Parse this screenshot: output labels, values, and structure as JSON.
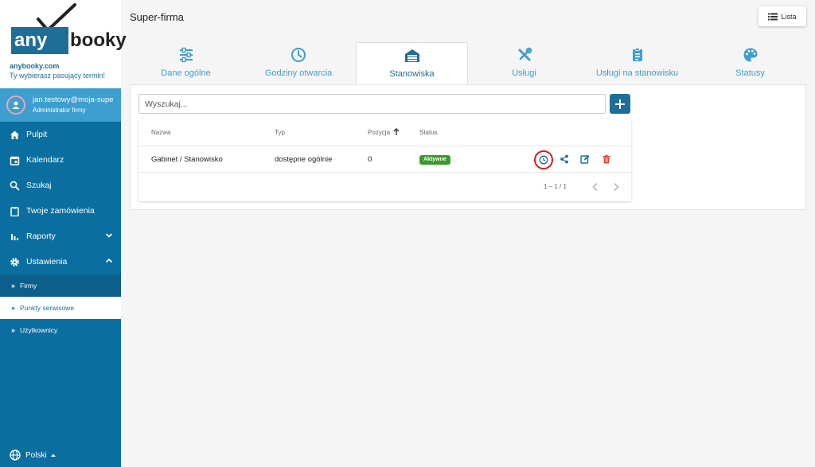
{
  "brand": {
    "logo_left": "any",
    "logo_right": "booky",
    "site": "anybooky.com",
    "tagline": "Ty wybierasz pasujący termin!"
  },
  "user": {
    "email": "jan.testowy@moja-supe",
    "role": "Administrator firmy"
  },
  "sidebar": {
    "items": [
      {
        "label": "Pulpit",
        "icon": "home-icon"
      },
      {
        "label": "Kalendarz",
        "icon": "calendar-icon"
      },
      {
        "label": "Szukaj",
        "icon": "search-icon"
      },
      {
        "label": "Twoje zamówienia",
        "icon": "clipboard-icon"
      },
      {
        "label": "Raporty",
        "icon": "bar-chart-icon"
      },
      {
        "label": "Ustawienia",
        "icon": "gear-icon"
      }
    ],
    "subitems": [
      {
        "label": "Firmy"
      },
      {
        "label": "Punkty serwisowe"
      },
      {
        "label": "Użytkownicy"
      }
    ],
    "language": "Polski"
  },
  "header": {
    "title": "Super-firma",
    "list_button": "Lista"
  },
  "tabs": [
    {
      "label": "Dane ogólne",
      "icon": "sliders-icon"
    },
    {
      "label": "Godziny otwarcia",
      "icon": "clock-icon"
    },
    {
      "label": "Stanowiska",
      "icon": "garage-icon"
    },
    {
      "label": "Usługi",
      "icon": "tools-icon"
    },
    {
      "label": "Usługi na stanowisku",
      "icon": "clipboard-list-icon"
    },
    {
      "label": "Statusy",
      "icon": "palette-icon"
    }
  ],
  "search": {
    "placeholder": "Wyszukaj..."
  },
  "table": {
    "columns": [
      "Nazwa",
      "Typ",
      "Pozycja",
      "Status"
    ],
    "rows": [
      {
        "name": "Gabinet / Stanowisko",
        "type": "dostępne ogólnie",
        "position": "0",
        "status": "Aktywne"
      }
    ],
    "pagination": "1 – 1 / 1"
  },
  "colors": {
    "sidebar": "#0a6ea0",
    "accent": "#1f6e98",
    "light_accent": "#3d9fd0",
    "status_active": "#3a9a2a",
    "delete": "#e53935",
    "highlight_ring": "#e8151b"
  }
}
